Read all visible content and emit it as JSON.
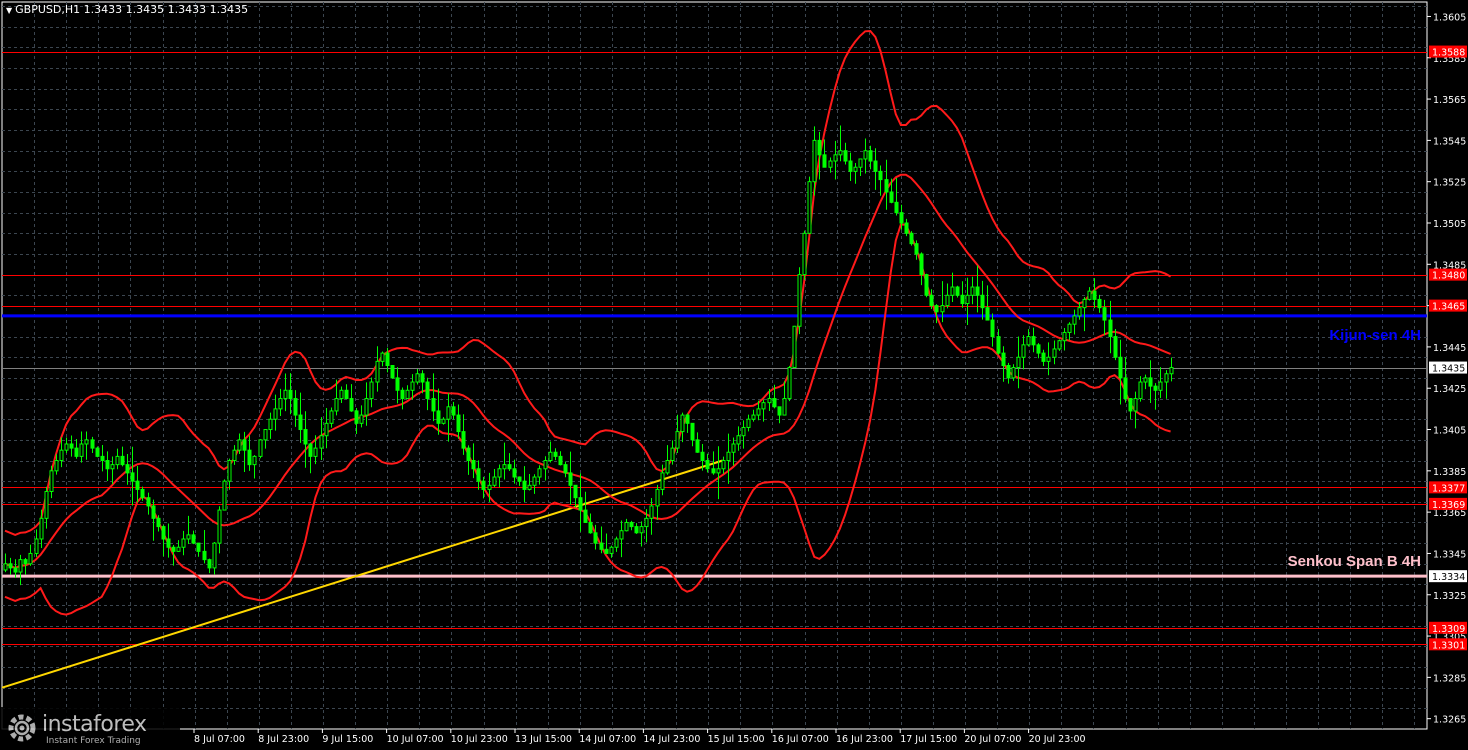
{
  "header": {
    "symbol_text": "GBPUSD,H1  1.3433 1.3435 1.3433 1.3435"
  },
  "watermark": {
    "brand": "instaforex",
    "tagline": "Instant Forex Trading",
    "icon": "instaforex-gear-logo-icon"
  },
  "colors": {
    "background": "#000000",
    "grid": "#3c4650",
    "candle": "#00ff00",
    "bands": "#ff1a1a",
    "kijun": "#0000ff",
    "senkou": "#ffc0cb",
    "levels": "#ff0000",
    "trendline": "#ffd700",
    "axis_text": "#ffffff",
    "current_price_line": "#808080"
  },
  "chart_data": {
    "type": "candlestick",
    "symbol": "GBPUSD",
    "timeframe": "H1",
    "ylim": [
      1.326,
      1.3612
    ],
    "y_ticks": [
      "1.3605",
      "1.3585",
      "1.3565",
      "1.3545",
      "1.3525",
      "1.3505",
      "1.3485",
      "1.3465",
      "1.3445",
      "1.3425",
      "1.3405",
      "1.3385",
      "1.3365",
      "1.3345",
      "1.3325",
      "1.3305",
      "1.3285",
      "1.3265"
    ],
    "x_ticks": [
      "8 Jul 07:00",
      "8 Jul 23:00",
      "9 Jul 15:00",
      "10 Jul 07:00",
      "10 Jul 23:00",
      "13 Jul 15:00",
      "14 Jul 07:00",
      "14 Jul 23:00",
      "15 Jul 15:00",
      "16 Jul 07:00",
      "16 Jul 23:00",
      "17 Jul 15:00",
      "20 Jul 07:00",
      "20 Jul 23:00"
    ],
    "current_price": 1.3435,
    "current_price_label": "1.3435",
    "levels": [
      {
        "price": 1.3588,
        "label": "1.3588",
        "kind": "resistance"
      },
      {
        "price": 1.348,
        "label": "1.3480",
        "kind": "resistance"
      },
      {
        "price": 1.3465,
        "label": "1.3465",
        "kind": "resistance"
      },
      {
        "price": 1.3377,
        "label": "1.3377",
        "kind": "support"
      },
      {
        "price": 1.3369,
        "label": "1.3369",
        "kind": "support"
      },
      {
        "price": 1.3309,
        "label": "1.3309",
        "kind": "support"
      },
      {
        "price": 1.3301,
        "label": "1.3301",
        "kind": "support"
      }
    ],
    "kijun_sen": {
      "price": 1.346,
      "label": "Kijun-sen 4H"
    },
    "senkou_span_b": {
      "price": 1.3334,
      "label": "Senkou Span B 4H",
      "price_label": "1.3334"
    },
    "trendline": {
      "from": [
        0,
        1.328
      ],
      "to": [
        141,
        1.339
      ]
    },
    "close_series": [
      1.334,
      1.3338,
      1.3336,
      1.3342,
      1.334,
      1.3345,
      1.3352,
      1.3362,
      1.3375,
      1.3385,
      1.339,
      1.3395,
      1.3398,
      1.3396,
      1.3392,
      1.3398,
      1.34,
      1.3396,
      1.3392,
      1.339,
      1.3386,
      1.3388,
      1.3392,
      1.3388,
      1.3384,
      1.338,
      1.3376,
      1.3372,
      1.3368,
      1.3362,
      1.3358,
      1.3352,
      1.3348,
      1.3346,
      1.3348,
      1.3352,
      1.3354,
      1.335,
      1.3346,
      1.3342,
      1.3338,
      1.335,
      1.3366,
      1.338,
      1.339,
      1.3395,
      1.34,
      1.3395,
      1.3388,
      1.3392,
      1.34,
      1.3405,
      1.341,
      1.3415,
      1.342,
      1.3424,
      1.342,
      1.3412,
      1.3405,
      1.3398,
      1.3392,
      1.3396,
      1.3402,
      1.3408,
      1.3414,
      1.342,
      1.3424,
      1.342,
      1.3414,
      1.3408,
      1.3412,
      1.342,
      1.3428,
      1.3438,
      1.3442,
      1.3436,
      1.343,
      1.3424,
      1.342,
      1.3424,
      1.3428,
      1.3432,
      1.3428,
      1.342,
      1.3414,
      1.3408,
      1.341,
      1.3416,
      1.3412,
      1.3404,
      1.3396,
      1.339,
      1.3386,
      1.338,
      1.3376,
      1.3378,
      1.3382,
      1.3386,
      1.3388,
      1.3386,
      1.3382,
      1.338,
      1.3376,
      1.3378,
      1.3382,
      1.3386,
      1.339,
      1.3394,
      1.3392,
      1.3388,
      1.3384,
      1.3378,
      1.3372,
      1.3366,
      1.336,
      1.3355,
      1.335,
      1.3347,
      1.3345,
      1.3348,
      1.3352,
      1.3356,
      1.336,
      1.3358,
      1.3355,
      1.3358,
      1.3362,
      1.3368,
      1.3376,
      1.3384,
      1.339,
      1.3396,
      1.3404,
      1.3412,
      1.3408,
      1.34,
      1.3394,
      1.339,
      1.3386,
      1.3384,
      1.3386,
      1.339,
      1.3394,
      1.3398,
      1.3402,
      1.3406,
      1.341,
      1.3412,
      1.3415,
      1.3418,
      1.342,
      1.3416,
      1.3412,
      1.342,
      1.3435,
      1.3455,
      1.348,
      1.35,
      1.3525,
      1.3545,
      1.3538,
      1.3532,
      1.3535,
      1.3538,
      1.354,
      1.3535,
      1.353,
      1.3532,
      1.3536,
      1.354,
      1.3535,
      1.353,
      1.3526,
      1.352,
      1.3515,
      1.351,
      1.3505,
      1.35,
      1.3495,
      1.349,
      1.348,
      1.347,
      1.3465,
      1.3462,
      1.3465,
      1.347,
      1.3474,
      1.347,
      1.3466,
      1.347,
      1.3474,
      1.347,
      1.3464,
      1.3458,
      1.345,
      1.3442,
      1.3436,
      1.343,
      1.3435,
      1.344,
      1.3446,
      1.345,
      1.3446,
      1.3442,
      1.3438,
      1.344,
      1.3444,
      1.3448,
      1.3452,
      1.3456,
      1.346,
      1.3464,
      1.3468,
      1.3472,
      1.3468,
      1.3464,
      1.3458,
      1.345,
      1.344,
      1.343,
      1.342,
      1.3414,
      1.342,
      1.3428,
      1.343,
      1.3426,
      1.3424,
      1.3428,
      1.3432,
      1.3435
    ]
  }
}
